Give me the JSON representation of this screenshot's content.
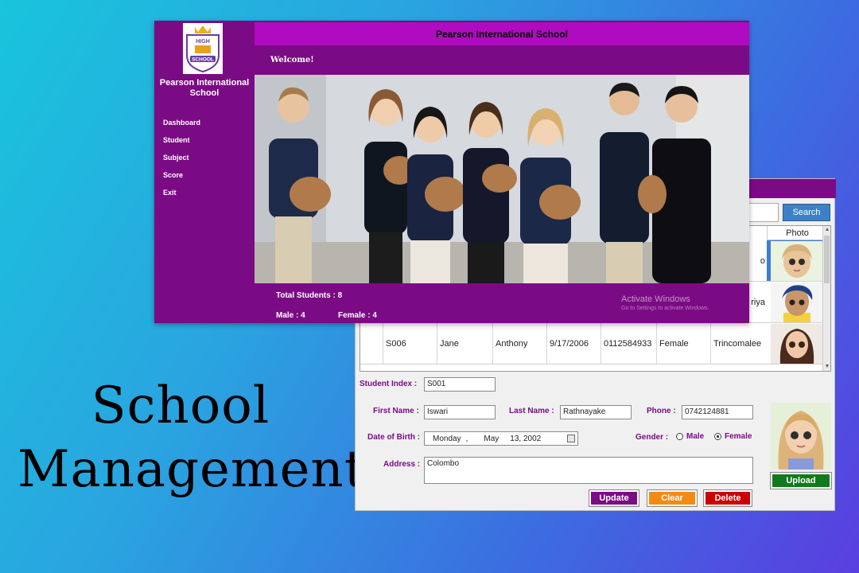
{
  "banner": {
    "line1": "School",
    "line2": "Management"
  },
  "dashboard": {
    "school_name": "Pearson International School",
    "sidebar_title_line1": "Pearson International",
    "sidebar_title_line2": "School",
    "logo_top": "HIGH",
    "logo_bottom": "SCHOOL",
    "nav": [
      "Dashboard",
      "Student",
      "Subject",
      "Score",
      "Exit"
    ],
    "welcome": "Welcome!",
    "total_students": "Total Students : 8",
    "male": "Male : 4",
    "female": "Female : 4",
    "activate_title": "Activate Windows",
    "activate_sub": "Go to Settings to activate Windows."
  },
  "student_form": {
    "search_label": "Search",
    "grid": {
      "photo_header": "Photo",
      "rows": [
        {
          "partial_text": "o",
          "selected": true
        },
        {
          "partial_text": "riya",
          "selected": false
        },
        {
          "id": "S006",
          "first": "Jane",
          "last": "Anthony",
          "dob": "9/17/2006",
          "phone": "0112584933",
          "gender": "Female",
          "address": "Trincomalee",
          "selected": false
        }
      ]
    },
    "labels": {
      "index": "Student Index :",
      "first": "First Name :",
      "last": "Last Name :",
      "phone": "Phone :",
      "dob": "Date of Birth :",
      "gender": "Gender :",
      "male": "Male",
      "female": "Female",
      "address": "Address :"
    },
    "values": {
      "index": "S001",
      "first": "Iswari",
      "last": "Rathnayake",
      "phone": "0742124881",
      "dob_day": "Monday",
      "dob_sep": ",",
      "dob_month": "May",
      "dob_date": "13, 2002",
      "gender": "Female",
      "address": "Colombo"
    },
    "buttons": {
      "update": "Update",
      "clear": "Clear",
      "delete": "Delete",
      "upload": "Upload"
    }
  },
  "colors": {
    "purple": "#7b0b84",
    "magenta": "#b00bc0",
    "clear_orange": "#f58a12",
    "delete_red": "#cc0000",
    "upload_green": "#127a1a",
    "search_blue": "#3c80c8"
  }
}
